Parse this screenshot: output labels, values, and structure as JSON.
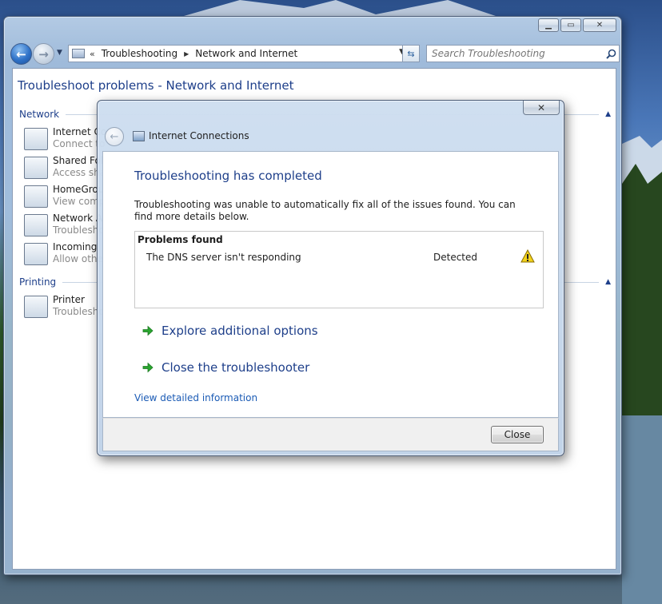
{
  "explorer": {
    "breadcrumb": {
      "overflow": "«",
      "items": [
        "Troubleshooting",
        "Network and Internet"
      ]
    },
    "search": {
      "placeholder": "Search Troubleshooting"
    },
    "page_title": "Troubleshoot problems - Network and Internet",
    "groups": [
      {
        "label": "Network",
        "tasks": [
          {
            "title": "Internet Co",
            "desc": "Connect to",
            "icon": "internet-connections-icon"
          },
          {
            "title": "Shared Fol",
            "desc": "Access sha",
            "icon": "shared-folders-icon"
          },
          {
            "title": "HomeGrou",
            "desc": "View comp",
            "icon": "homegroup-icon"
          },
          {
            "title": "Network A",
            "desc": "Troublesho",
            "icon": "network-adapter-icon"
          },
          {
            "title": "Incoming",
            "desc": "Allow othe",
            "icon": "incoming-connections-icon"
          }
        ]
      },
      {
        "label": "Printing",
        "tasks": [
          {
            "title": "Printer",
            "desc": "Troublesho",
            "icon": "printer-icon"
          }
        ]
      }
    ]
  },
  "dialog": {
    "title": "Internet Connections",
    "heading": "Troubleshooting has completed",
    "message": "Troubleshooting was unable to automatically fix all of the issues found. You can find more details below.",
    "problems": {
      "header": "Problems found",
      "items": [
        {
          "name": "The DNS server isn't responding",
          "status": "Detected",
          "icon": "warning-icon"
        }
      ]
    },
    "options": [
      "Explore additional options",
      "Close the troubleshooter"
    ],
    "detail_link": "View detailed information",
    "close_button": "Close"
  },
  "colors": {
    "link": "#1e3f8a",
    "hyperlink": "#1b5bb5",
    "arrow": "#2aa52f",
    "warning": "#f2d21b"
  }
}
